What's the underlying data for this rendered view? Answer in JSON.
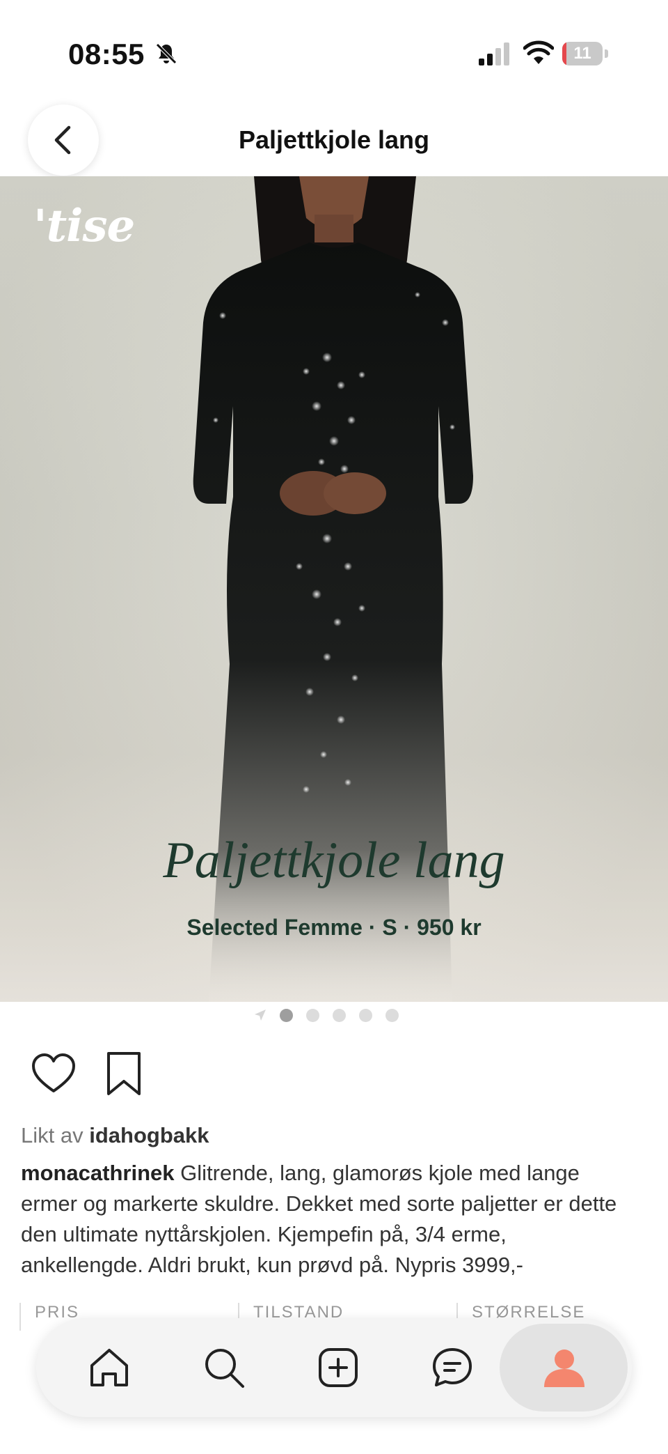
{
  "status_bar": {
    "time": "08:55",
    "battery": "11",
    "battery_level": 0.11
  },
  "header": {
    "title": "Paljettkjole lang"
  },
  "hero": {
    "logo": "'tise",
    "title": "Paljettkjole lang",
    "subtitle": "Selected Femme · S · 950 kr",
    "image_count": 5,
    "active_index": 0
  },
  "likes": {
    "prefix": "Likt av",
    "user": "idahogbakk"
  },
  "description": {
    "user": "monacathrinek",
    "text": " Glitrende, lang, glamorøs kjole med lange ermer og markerte skuldre. Dekket med sorte paljetter er dette den ultimate nyttårskjolen. Kjempefin på, 3/4 erme, ankellengde. Aldri brukt, kun prøvd på. Nypris 3999,-"
  },
  "details": {
    "price_label": "PRIS",
    "condition_label": "TILSTAND",
    "size_label": "STØRRELSE"
  },
  "bottom_nav": {
    "items": [
      "home-icon",
      "search-icon",
      "add-icon",
      "messages-icon",
      "profile-icon"
    ],
    "active": "profile-icon",
    "accent": "#f4866e"
  }
}
